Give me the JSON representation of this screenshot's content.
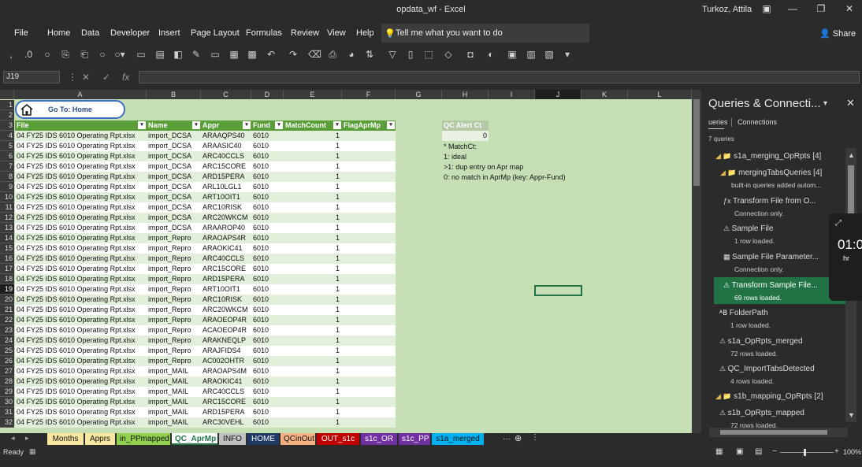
{
  "window": {
    "title": "opdata_wf - Excel",
    "user": "Turkoz, Attila"
  },
  "ribbon": {
    "tabs": [
      "File",
      "Home",
      "Data",
      "Developer",
      "Insert",
      "Page Layout",
      "Formulas",
      "Review",
      "View",
      "Help"
    ],
    "tell_me": "Tell me what you want to do",
    "share": "Share"
  },
  "formula_bar": {
    "name_box": "J19",
    "fx": "fx",
    "content": ""
  },
  "sheet": {
    "columns": [
      "A",
      "B",
      "C",
      "D",
      "E",
      "F",
      "G",
      "H",
      "I",
      "J",
      "K",
      "L"
    ],
    "goto_home": "Go To: Home",
    "headers": [
      "File",
      "Name",
      "Appr",
      "Fund",
      "MatchCount",
      "FlagAprMp"
    ],
    "rows": [
      [
        "04 FY25 IDS 6010 Operating Rpt.xlsx",
        "import_DCSA",
        "ARAAQPS40",
        "6010",
        "1"
      ],
      [
        "04 FY25 IDS 6010 Operating Rpt.xlsx",
        "import_DCSA",
        "ARAASIC40",
        "6010",
        "1"
      ],
      [
        "04 FY25 IDS 6010 Operating Rpt.xlsx",
        "import_DCSA",
        "ARC40CCLS",
        "6010",
        "1"
      ],
      [
        "04 FY25 IDS 6010 Operating Rpt.xlsx",
        "import_DCSA",
        "ARC15CORE",
        "6010",
        "1"
      ],
      [
        "04 FY25 IDS 6010 Operating Rpt.xlsx",
        "import_DCSA",
        "ARD15PERA",
        "6010",
        "1"
      ],
      [
        "04 FY25 IDS 6010 Operating Rpt.xlsx",
        "import_DCSA",
        "ARL10LGL1",
        "6010",
        "1"
      ],
      [
        "04 FY25 IDS 6010 Operating Rpt.xlsx",
        "import_DCSA",
        "ART10OIT1",
        "6010",
        "1"
      ],
      [
        "04 FY25 IDS 6010 Operating Rpt.xlsx",
        "import_DCSA",
        "ARC10RISK",
        "6010",
        "1"
      ],
      [
        "04 FY25 IDS 6010 Operating Rpt.xlsx",
        "import_DCSA",
        "ARC20WKCM",
        "6010",
        "1"
      ],
      [
        "04 FY25 IDS 6010 Operating Rpt.xlsx",
        "import_DCSA",
        "ARAAROP40",
        "6010",
        "1"
      ],
      [
        "04 FY25 IDS 6010 Operating Rpt.xlsx",
        "import_Repro",
        "ARAOAPS4R",
        "6010",
        "1"
      ],
      [
        "04 FY25 IDS 6010 Operating Rpt.xlsx",
        "import_Repro",
        "ARAOKIC41",
        "6010",
        "1"
      ],
      [
        "04 FY25 IDS 6010 Operating Rpt.xlsx",
        "import_Repro",
        "ARC40CCLS",
        "6010",
        "1"
      ],
      [
        "04 FY25 IDS 6010 Operating Rpt.xlsx",
        "import_Repro",
        "ARC15CORE",
        "6010",
        "1"
      ],
      [
        "04 FY25 IDS 6010 Operating Rpt.xlsx",
        "import_Repro",
        "ARD15PERA",
        "6010",
        "1"
      ],
      [
        "04 FY25 IDS 6010 Operating Rpt.xlsx",
        "import_Repro",
        "ART10OIT1",
        "6010",
        "1"
      ],
      [
        "04 FY25 IDS 6010 Operating Rpt.xlsx",
        "import_Repro",
        "ARC10RISK",
        "6010",
        "1"
      ],
      [
        "04 FY25 IDS 6010 Operating Rpt.xlsx",
        "import_Repro",
        "ARC20WKCM",
        "6010",
        "1"
      ],
      [
        "04 FY25 IDS 6010 Operating Rpt.xlsx",
        "import_Repro",
        "ARAOEOP4R",
        "6010",
        "1"
      ],
      [
        "04 FY25 IDS 6010 Operating Rpt.xlsx",
        "import_Repro",
        "ACAOEOP4R",
        "6010",
        "1"
      ],
      [
        "04 FY25 IDS 6010 Operating Rpt.xlsx",
        "import_Repro",
        "ARAKNEQLP",
        "6010",
        "1"
      ],
      [
        "04 FY25 IDS 6010 Operating Rpt.xlsx",
        "import_Repro",
        "ARAJFIDS4",
        "6010",
        "1"
      ],
      [
        "04 FY25 IDS 6010 Operating Rpt.xlsx",
        "import_Repro",
        "AC002OHTR",
        "6010",
        "1"
      ],
      [
        "04 FY25 IDS 6010 Operating Rpt.xlsx",
        "import_MAIL",
        "ARAOAPS4M",
        "6010",
        "1"
      ],
      [
        "04 FY25 IDS 6010 Operating Rpt.xlsx",
        "import_MAIL",
        "ARAOKIC41",
        "6010",
        "1"
      ],
      [
        "04 FY25 IDS 6010 Operating Rpt.xlsx",
        "import_MAIL",
        "ARC40CCLS",
        "6010",
        "1"
      ],
      [
        "04 FY25 IDS 6010 Operating Rpt.xlsx",
        "import_MAIL",
        "ARC15CORE",
        "6010",
        "1"
      ],
      [
        "04 FY25 IDS 6010 Operating Rpt.xlsx",
        "import_MAIL",
        "ARD15PERA",
        "6010",
        "1"
      ],
      [
        "04 FY25 IDS 6010 Operating Rpt.xlsx",
        "import_MAIL",
        "ARC30VEHL",
        "6010",
        "1"
      ]
    ],
    "qc": {
      "title": "QC Alert Ct",
      "value": "0",
      "notes": [
        "* MatchCt:",
        "1: ideal",
        ">1: dup entry on Apr map",
        "0: no match in AprMp (key: Appr-Fund)"
      ]
    }
  },
  "sheet_tabs": [
    {
      "label": "Months",
      "color": "#f7e7a1"
    },
    {
      "label": "Apprs",
      "color": "#f7e7a1"
    },
    {
      "label": "in_PPmapped",
      "color": "#92d050"
    },
    {
      "label": "QC_AprMp",
      "color": "#ffffff"
    },
    {
      "label": "INFO",
      "color": "#bfbfbf"
    },
    {
      "label": "HOME",
      "color": "#1f3864"
    },
    {
      "label": "QCinOut",
      "color": "#f4b183"
    },
    {
      "label": "OUT_s1c",
      "color": "#c00000"
    },
    {
      "label": "s1c_OR",
      "color": "#7030a0"
    },
    {
      "label": "s1c_PP",
      "color": "#7030a0"
    },
    {
      "label": "s1a_merged",
      "color": "#00b0f0"
    }
  ],
  "status": {
    "ready": "Ready",
    "zoom": "100%"
  },
  "queries_pane": {
    "title": "Queries & Connecti...",
    "tabs": [
      "ueries",
      "Connections"
    ],
    "count": "7 queries",
    "items": [
      {
        "label": "s1a_merging_OpRpts [4]",
        "sub": "",
        "kind": "folder"
      },
      {
        "label": "mergingTabsQueries [4]",
        "sub": "built-in queries added autom...",
        "kind": "folder"
      },
      {
        "label": "Transform File from O...",
        "sub": "Connection only.",
        "kind": "fx"
      },
      {
        "label": "Sample File",
        "sub": "1 row loaded.",
        "kind": "warn"
      },
      {
        "label": "Sample File Parameter...",
        "sub": "Connection only.",
        "kind": "table"
      },
      {
        "label": "Transform Sample File...",
        "sub": "69 rows loaded.",
        "kind": "warn"
      },
      {
        "label": "FolderPath",
        "sub": "1 row loaded.",
        "kind": "abc"
      },
      {
        "label": "s1a_OpRpts_merged",
        "sub": "72 rows loaded.",
        "kind": "warn"
      },
      {
        "label": "QC_ImportTabsDetected",
        "sub": "4 rows loaded.",
        "kind": "warn"
      },
      {
        "label": "s1b_mapping_OpRpts [2]",
        "sub": "",
        "kind": "folder"
      },
      {
        "label": "s1b_OpRpts_mapped",
        "sub": "72 rows loaded.",
        "kind": "warn"
      }
    ]
  },
  "clock": {
    "time": "01:0",
    "unit": "hr"
  }
}
